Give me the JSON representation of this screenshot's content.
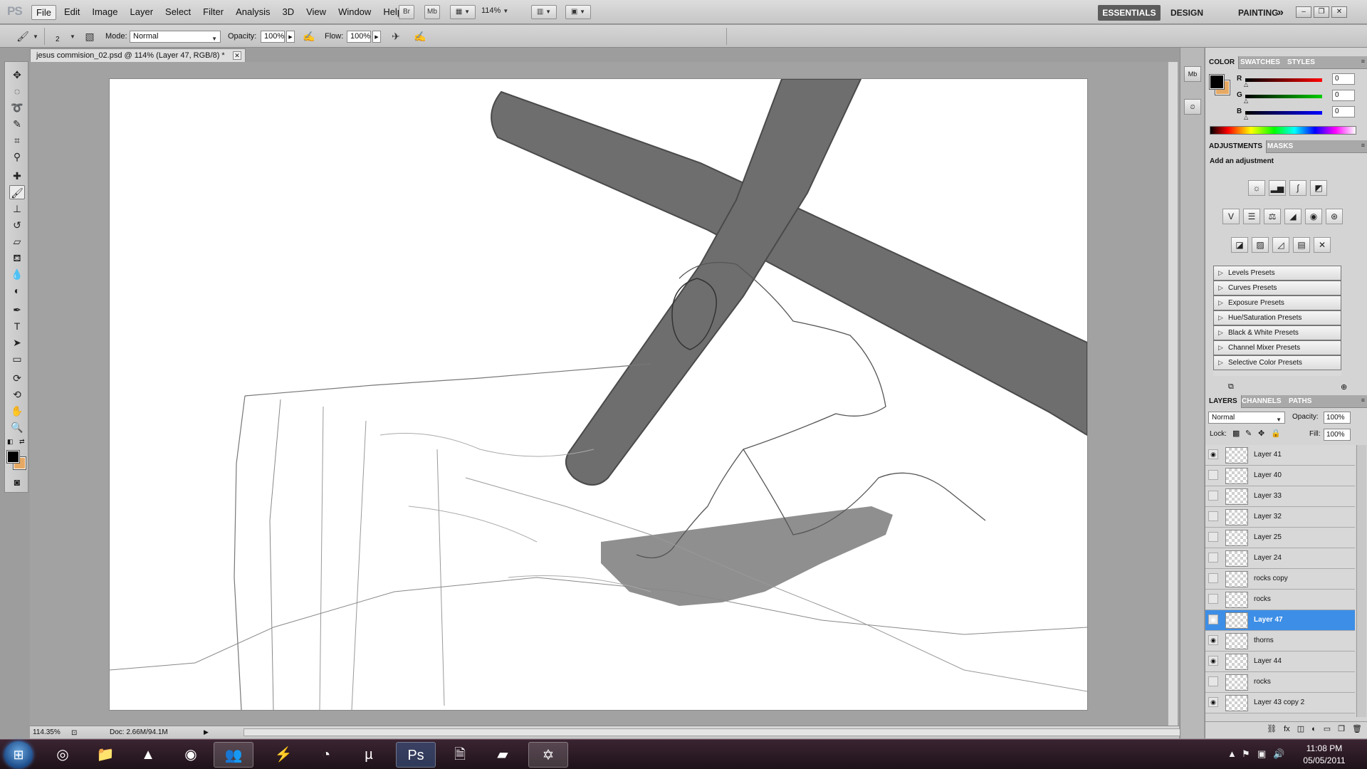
{
  "menubar": {
    "logo": "PS",
    "menus": [
      "File",
      "Edit",
      "Image",
      "Layer",
      "Select",
      "Filter",
      "Analysis",
      "3D",
      "View",
      "Window",
      "Help"
    ],
    "bridge_label": "Br",
    "minibridge_label": "Mb",
    "zoom": "114%",
    "workspaces": {
      "essentials": "ESSENTIALS",
      "design": "DESIGN",
      "painting": "PAINTING",
      "more": "»"
    }
  },
  "options": {
    "brush_size": "2",
    "mode_label": "Mode:",
    "mode_value": "Normal",
    "opacity_label": "Opacity:",
    "opacity_value": "100%",
    "flow_label": "Flow:",
    "flow_value": "100%"
  },
  "document": {
    "tab_title": "jesus commision_02.psd @ 114% (Layer 47, RGB/8) *",
    "zoom_status": "114.35%",
    "doc_size": "Doc: 2.66M/94.1M"
  },
  "color_panel": {
    "tabs": [
      "COLOR",
      "SWATCHES",
      "STYLES"
    ],
    "channels": [
      {
        "name": "R",
        "value": "0",
        "color": "#e00000"
      },
      {
        "name": "G",
        "value": "0",
        "color": "#00b000"
      },
      {
        "name": "B",
        "value": "0",
        "color": "#0000e0"
      }
    ],
    "foreground": "#000000",
    "background": "#e6a964"
  },
  "adjustments_panel": {
    "tabs": [
      "ADJUSTMENTS",
      "MASKS"
    ],
    "heading": "Add an adjustment",
    "presets": [
      "Levels Presets",
      "Curves Presets",
      "Exposure Presets",
      "Hue/Saturation Presets",
      "Black & White Presets",
      "Channel Mixer Presets",
      "Selective Color Presets"
    ]
  },
  "layers_panel": {
    "tabs": [
      "LAYERS",
      "CHANNELS",
      "PATHS"
    ],
    "blend_mode": "Normal",
    "opacity_label": "Opacity:",
    "opacity_value": "100%",
    "lock_label": "Lock:",
    "fill_label": "Fill:",
    "fill_value": "100%",
    "layers": [
      {
        "name": "Layer 41",
        "visible": true,
        "selected": false
      },
      {
        "name": "Layer 40",
        "visible": false,
        "selected": false
      },
      {
        "name": "Layer 33",
        "visible": false,
        "selected": false
      },
      {
        "name": "Layer 32",
        "visible": false,
        "selected": false
      },
      {
        "name": "Layer 25",
        "visible": false,
        "selected": false
      },
      {
        "name": "Layer 24",
        "visible": false,
        "selected": false
      },
      {
        "name": "rocks copy",
        "visible": false,
        "selected": false
      },
      {
        "name": "rocks",
        "visible": false,
        "selected": false
      },
      {
        "name": "Layer 47",
        "visible": true,
        "selected": true
      },
      {
        "name": "thorns",
        "visible": true,
        "selected": false
      },
      {
        "name": "Layer 44",
        "visible": true,
        "selected": false
      },
      {
        "name": "rocks",
        "visible": false,
        "selected": false
      },
      {
        "name": "Layer 43 copy 2",
        "visible": true,
        "selected": false
      }
    ]
  },
  "taskbar": {
    "apps": [
      "chrome-icon",
      "explorer-icon",
      "vlc-icon",
      "eye-app-icon",
      "messenger-icon",
      "winamp-icon",
      "steam-icon",
      "utorrent-icon",
      "photoshop-icon",
      "notepad-icon",
      "eraser-app-icon",
      "star-app-icon"
    ],
    "photoshop_label": "Ps",
    "time": "11:08 PM",
    "date": "05/05/2011"
  },
  "colors": {
    "selection_blue": "#3d8ee6",
    "panel_bg": "#d4d4d4",
    "taskbar_bg": "#2a1823"
  }
}
